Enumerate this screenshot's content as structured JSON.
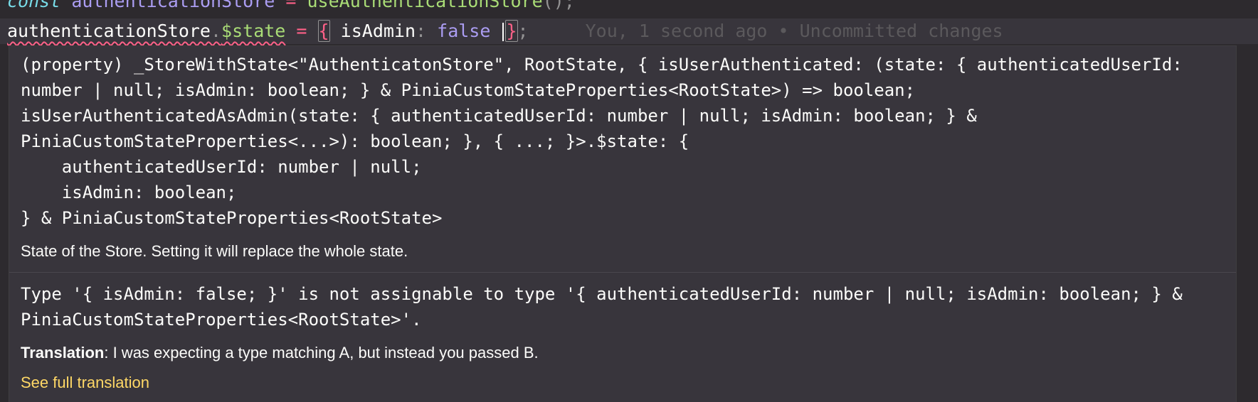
{
  "editor": {
    "line1": {
      "keyword": "const",
      "variable": "authenticationStore",
      "equals": "=",
      "function": "useAuthenticationStore",
      "tail": "();"
    },
    "line2": {
      "object": "authenticationStore",
      "dot": ".",
      "property": "$state",
      "equals": "=",
      "open": "{",
      "key": "isAdmin",
      "colon": ":",
      "value": "false",
      "close": "}",
      "semi": ";",
      "blame": "You, 1 second ago • Uncommitted changes"
    }
  },
  "hover": {
    "signature_text": "(property) _StoreWithState<\"AuthenticatonStore\", RootState, { isUserAuthenticated: (state: { authenticatedUserId: number | null; isAdmin: boolean; } & PiniaCustomStateProperties<RootState>) => boolean; isUserAuthenticatedAsAdmin(state: { authenticatedUserId: number | null; isAdmin: boolean; } & PiniaCustomStateProperties<...>): boolean; }, { ...; }>.$state: {\n    authenticatedUserId: number | null;\n    isAdmin: boolean;\n} & PiniaCustomStateProperties<RootState>",
    "doc": "State of the Store. Setting it will replace the whole state.",
    "error": "Type '{ isAdmin: false; }' is not assignable to type '{ authenticatedUserId: number | null; isAdmin: boolean; } & PiniaCustomStateProperties<RootState>'.",
    "translation_label": "Translation",
    "translation_text": ": I was expecting a type matching A, but instead you passed B.",
    "link": "See full translation"
  },
  "colors": {
    "background": "#2d2a2e",
    "hover_bg": "#38353c",
    "keyword": "#78dce8",
    "string": "#ffd866",
    "function": "#a9dc76",
    "operator": "#ff6188",
    "constant": "#ab9df2",
    "link": "#ffd866"
  }
}
